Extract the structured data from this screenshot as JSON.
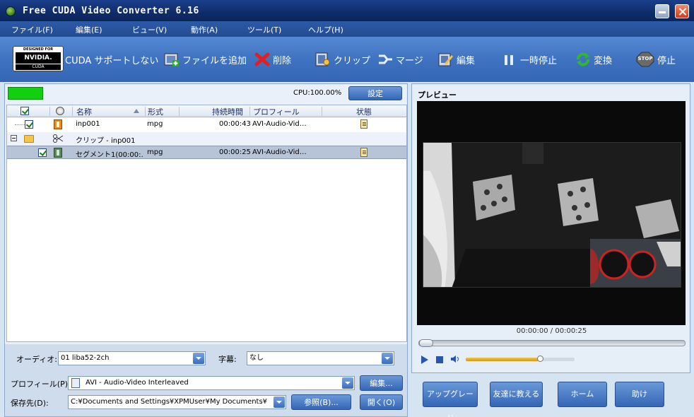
{
  "window": {
    "title": "Free CUDA Video Converter 6.16"
  },
  "menu": [
    "ファイル(F)",
    "編集(E)",
    "ビュー(V)",
    "動作(A)",
    "ツール(T)",
    "ヘルプ(H)"
  ],
  "toolbar": {
    "badge_top": "DESIGNED FOR",
    "badge_mid": "NVIDIA.",
    "badge_bot": "CUDA",
    "cuda_label": "CUDA サポートしない",
    "add_file": "ファイルを追加",
    "delete": "削除",
    "clip": "クリップ",
    "merge": "マージ",
    "edit": "編集",
    "pause": "一時停止",
    "convert": "変換",
    "stop": "停止",
    "stop_icon_text": "STOP"
  },
  "cpu": {
    "label": "CPU:100.00%",
    "settings": "設定"
  },
  "filelist": {
    "headers": {
      "name": "名称",
      "format": "形式",
      "duration": "持続時間",
      "profile": "プロフィール",
      "status": "状態"
    },
    "rows": [
      {
        "name": "inp001",
        "format": "mpg",
        "duration": "00:00:43",
        "profile": "AVI-Audio-Vid…"
      },
      {
        "name": "クリップ - inp001"
      },
      {
        "name": "セグメント1(00:00:…",
        "format": "mpg",
        "duration": "00:00:25",
        "profile": "AVI-Audio-Vid…"
      }
    ]
  },
  "audio": {
    "label": "オーディオ:",
    "value": "01 liba52-2ch"
  },
  "subtitle": {
    "label": "字幕:",
    "value": "なし"
  },
  "profile": {
    "label": "プロフィール(P):",
    "value": "AVI - Audio-Video Interleaved",
    "edit_btn": "編集..."
  },
  "save": {
    "label": "保存先(D):",
    "value": "C:¥Documents and Settings¥XPMUser¥My Documents¥",
    "browse_btn": "参照(B)...",
    "open_btn": "開く(O)"
  },
  "preview": {
    "title": "プレビュー",
    "time": "00:00:00 / 00:00:25",
    "seek_fraction": 0.0,
    "volume_fraction": 0.68
  },
  "bottom_buttons": {
    "upgrade": "アップグレード",
    "tell_friend": "友達に教える",
    "home": "ホーム",
    "help": "助け"
  }
}
